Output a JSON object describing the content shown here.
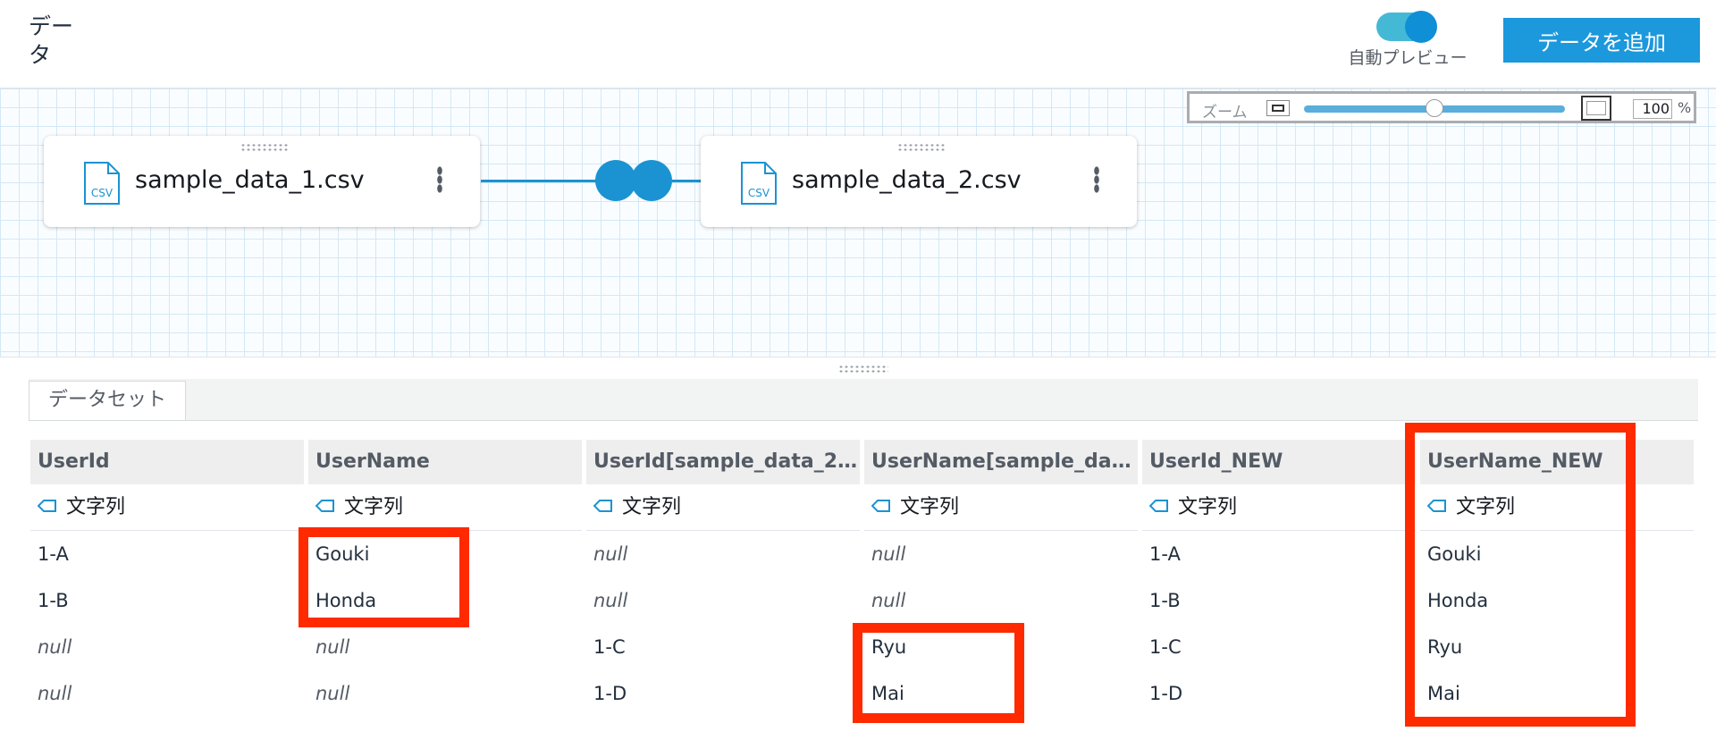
{
  "header": {
    "title": "データ",
    "auto_preview_label": "自動プレビュー",
    "auto_preview_on": true,
    "add_data_button": "データを追加"
  },
  "zoom": {
    "label": "ズーム",
    "value": "100",
    "unit": "%",
    "slider_fraction": 0.5
  },
  "nodes": [
    {
      "file_name": "sample_data_1.csv",
      "icon_text": "CSV"
    },
    {
      "file_name": "sample_data_2.csv",
      "icon_text": "CSV"
    }
  ],
  "dataset": {
    "tab_label": "データセット",
    "columns": [
      {
        "header": "UserId",
        "type": "文字列",
        "cells": [
          "1-A",
          "1-B",
          "null",
          "null"
        ]
      },
      {
        "header": "UserName",
        "type": "文字列",
        "cells": [
          "Gouki",
          "Honda",
          "null",
          "null"
        ]
      },
      {
        "header": "UserId[sample_data_2.…",
        "type": "文字列",
        "cells": [
          "null",
          "null",
          "1-C",
          "1-D"
        ]
      },
      {
        "header": "UserName[sample_dat…",
        "type": "文字列",
        "cells": [
          "null",
          "null",
          "Ryu",
          "Mai"
        ]
      },
      {
        "header": "UserId_NEW",
        "type": "文字列",
        "cells": [
          "1-A",
          "1-B",
          "1-C",
          "1-D"
        ]
      },
      {
        "header": "UserName_NEW",
        "type": "文字列",
        "cells": [
          "Gouki",
          "Honda",
          "Ryu",
          "Mai"
        ]
      }
    ]
  },
  "colors": {
    "accent": "#1c98dc",
    "highlight": "#ff2a00",
    "connector": "#1b93d2"
  }
}
